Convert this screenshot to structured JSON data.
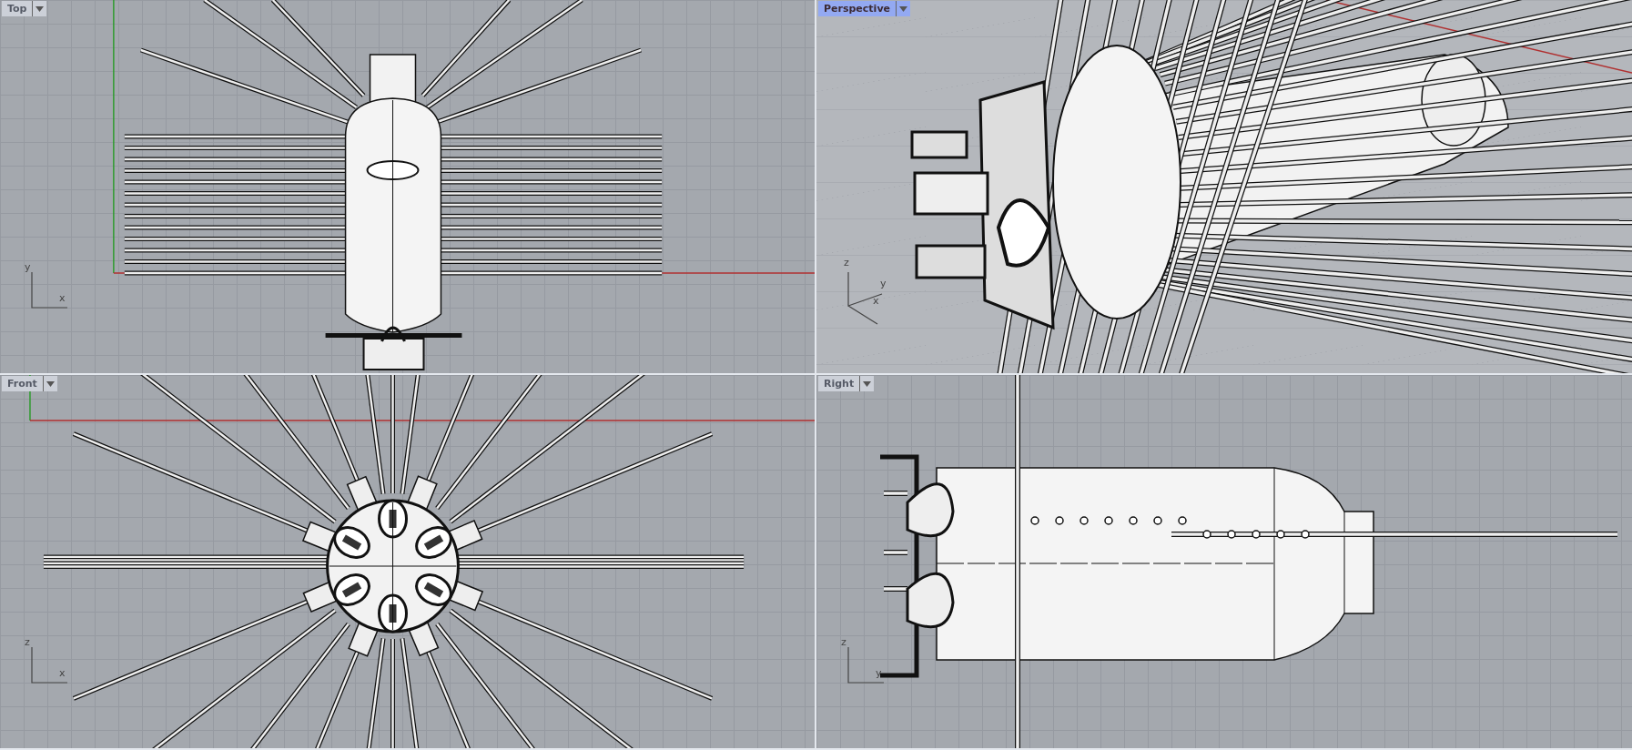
{
  "viewports": [
    {
      "kind": "top",
      "title": "Top",
      "selected": false,
      "axes": [
        "y",
        "x"
      ]
    },
    {
      "kind": "perspective",
      "title": "Perspective",
      "selected": true,
      "axes": [
        "z",
        "y",
        "x"
      ]
    },
    {
      "kind": "front",
      "title": "Front",
      "selected": false,
      "axes": [
        "z",
        "x"
      ]
    },
    {
      "kind": "right",
      "title": "Right",
      "selected": false,
      "axes": [
        "z",
        "y"
      ]
    }
  ]
}
